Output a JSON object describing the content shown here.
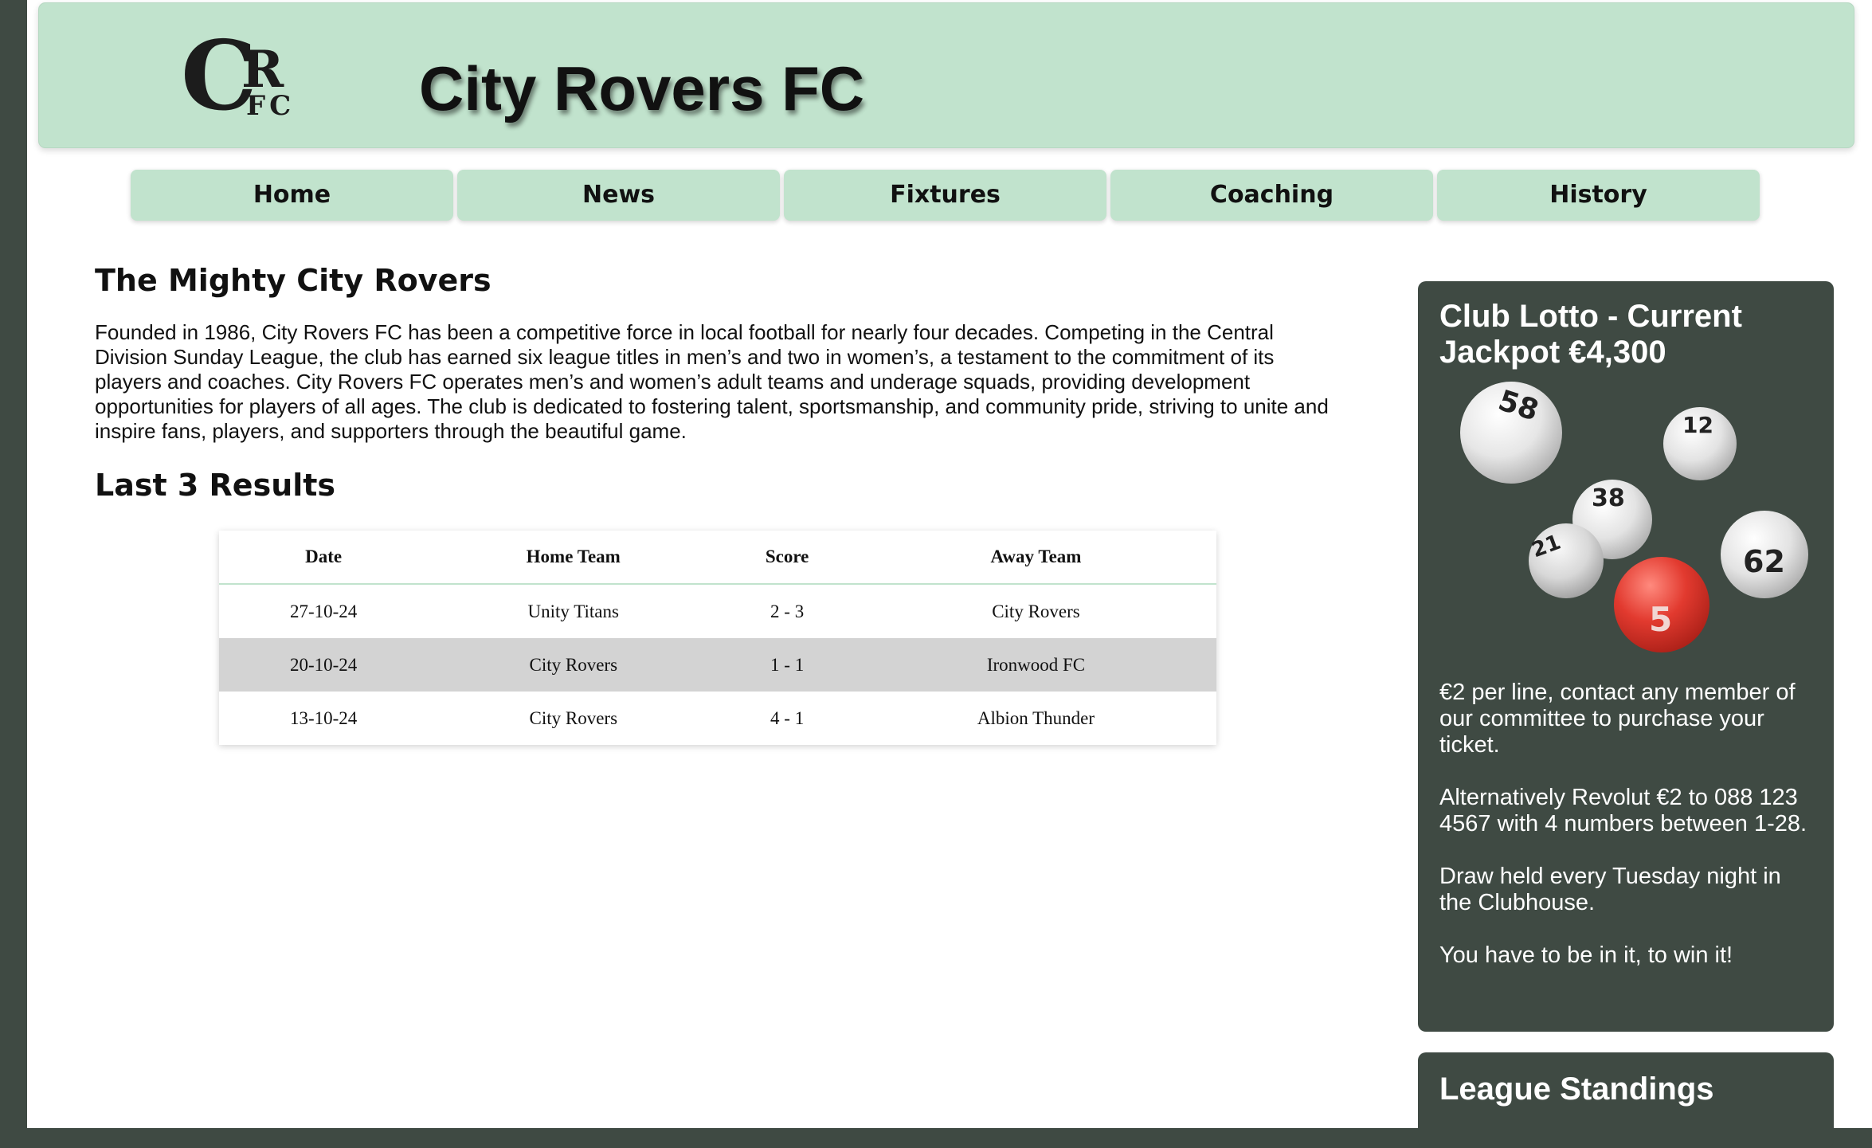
{
  "header": {
    "logo": {
      "c": "C",
      "r": "R",
      "fc": "FC"
    },
    "title": "City Rovers FC"
  },
  "nav": {
    "items": [
      {
        "label": "Home"
      },
      {
        "label": "News"
      },
      {
        "label": "Fixtures"
      },
      {
        "label": "Coaching"
      },
      {
        "label": "History"
      }
    ]
  },
  "main": {
    "heading": "The Mighty City Rovers",
    "intro": "Founded in 1986, City Rovers FC has been a competitive force in local football for nearly four decades. Competing in the Central Division Sunday League, the club has earned six league titles in men’s and two in women’s, a testament to the commitment of its players and coaches. City Rovers FC operates men’s and women’s adult teams and underage squads, providing development opportunities for players of all ages. The club is dedicated to fostering talent, sportsmanship, and community pride, striving to unite and inspire fans, players, and supporters through the beautiful game.",
    "results_heading": "Last 3 Results",
    "results": {
      "columns": [
        "Date",
        "Home Team",
        "Score",
        "Away Team"
      ],
      "rows": [
        [
          "27-10-24",
          "Unity Titans",
          "2 - 3",
          "City Rovers"
        ],
        [
          "20-10-24",
          "City Rovers",
          "1 - 1",
          "Ironwood FC"
        ],
        [
          "13-10-24",
          "City Rovers",
          "4 - 1",
          "Albion Thunder"
        ]
      ]
    }
  },
  "sidebar": {
    "lotto": {
      "title": "Club Lotto - Current Jackpot €4,300",
      "balls": [
        "58",
        "12",
        "38",
        "21",
        "62",
        "5"
      ],
      "paragraphs": [
        "€2 per line, contact any member of our committee to purchase your ticket.",
        "Alternatively Revolut €2 to 088 123 4567 with 4 numbers between 1-28.",
        "Draw held every Tuesday night in the Clubhouse.",
        "You have to be in it, to win it!"
      ]
    },
    "standings": {
      "title": "League Standings"
    }
  },
  "colors": {
    "accent": "#c1e3cd",
    "dark": "#3f4a43",
    "row_alt": "#d3d3d3",
    "lotto_ball_red": "#d9302a"
  }
}
